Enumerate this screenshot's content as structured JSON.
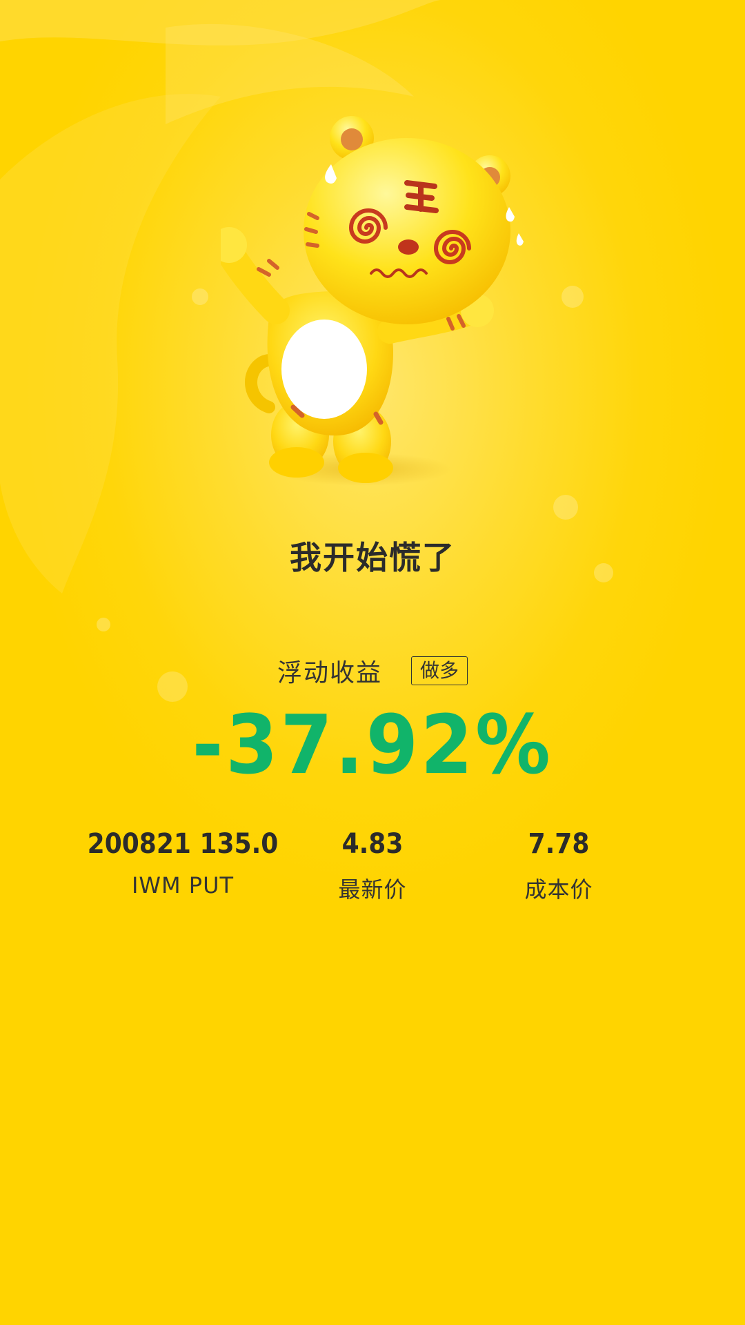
{
  "status": {
    "mood_title": "我开始慌了"
  },
  "pnl": {
    "label": "浮动收益",
    "direction": "做多",
    "value": "-37.92%",
    "color": "#11b46a"
  },
  "stats": [
    {
      "value": "200821 135.0",
      "label": "IWM PUT"
    },
    {
      "value": "4.83",
      "label": "最新价"
    },
    {
      "value": "7.78",
      "label": "成本价"
    }
  ],
  "mascot": {
    "icon": "panicked-tiger-mascot-icon"
  },
  "colors": {
    "background": "#ffd60a",
    "text": "#2b2b2b",
    "loss": "#11b46a"
  }
}
